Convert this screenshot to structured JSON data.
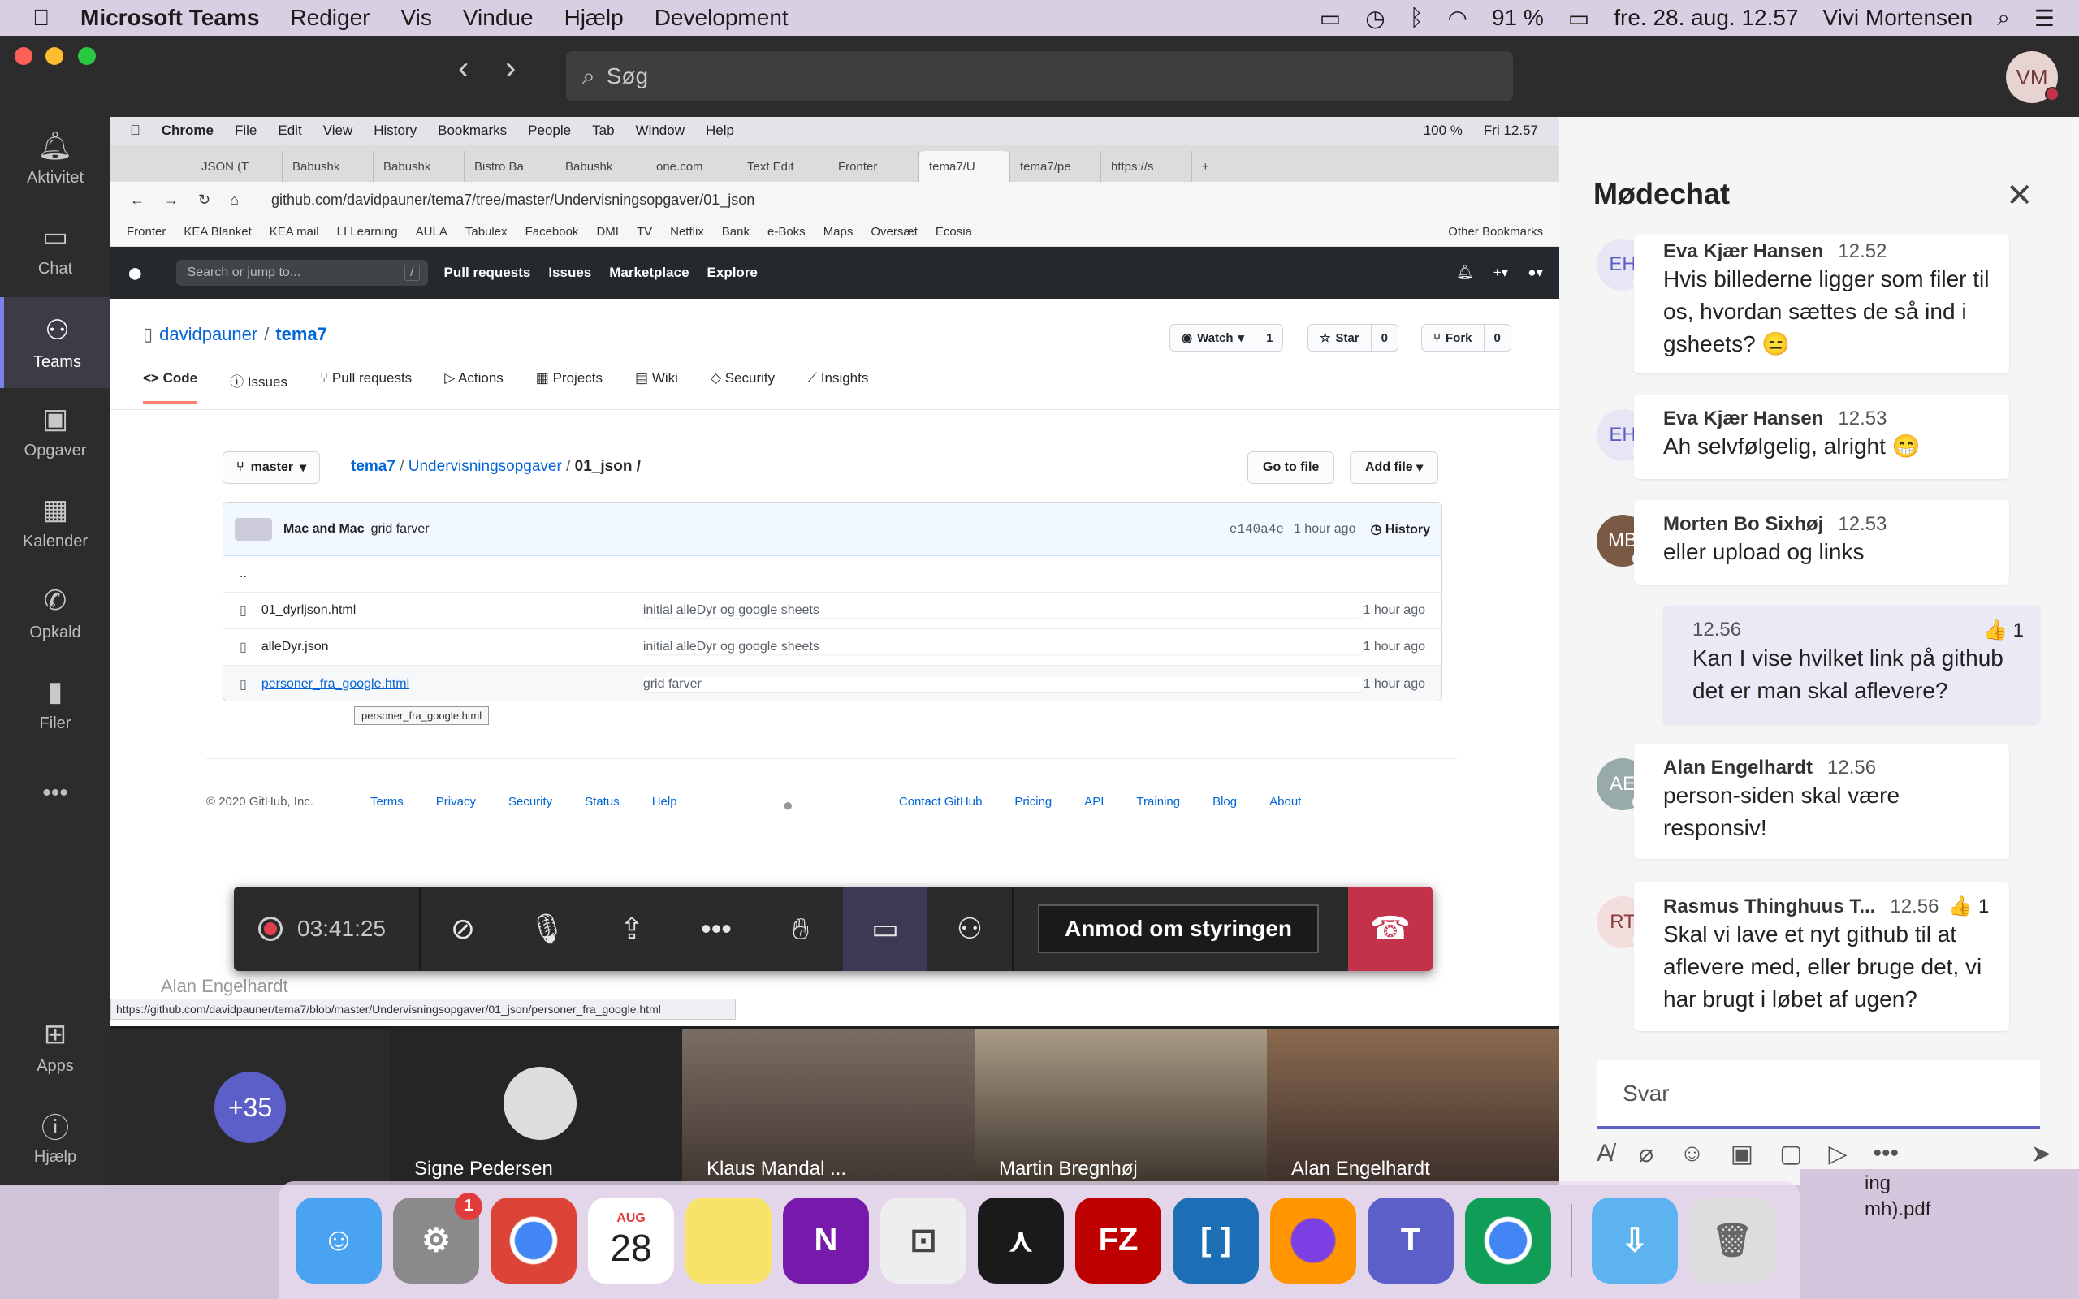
{
  "menubar": {
    "app": "Microsoft Teams",
    "items": [
      "Rediger",
      "Vis",
      "Vindue",
      "Hjælp",
      "Development"
    ],
    "battery": "91 %",
    "datetime": "fre. 28. aug. 12.57",
    "user": "Vivi Mortensen"
  },
  "teams": {
    "search_placeholder": "Søg",
    "avatar": "VM",
    "rail": [
      {
        "label": "Aktivitet",
        "icon": "bell-icon"
      },
      {
        "label": "Chat",
        "icon": "chat-icon"
      },
      {
        "label": "Teams",
        "icon": "teams-icon"
      },
      {
        "label": "Opgaver",
        "icon": "tasks-icon"
      },
      {
        "label": "Kalender",
        "icon": "calendar-icon"
      },
      {
        "label": "Opkald",
        "icon": "phone-icon"
      },
      {
        "label": "Filer",
        "icon": "files-icon"
      }
    ],
    "more": "•••",
    "apps": "Apps",
    "help": "Hjælp"
  },
  "chrome": {
    "mac_menu": [
      "Chrome",
      "File",
      "Edit",
      "View",
      "History",
      "Bookmarks",
      "People",
      "Tab",
      "Window",
      "Help"
    ],
    "mac_status": "100 %",
    "mac_time": "Fri 12.57",
    "tabs": [
      "JSON (T",
      "Babushk",
      "Babushk",
      "Bistro Ba",
      "Babushk",
      "one.com",
      "Text Edit",
      "Fronter",
      "tema7/U",
      "tema7/pe",
      "https://s"
    ],
    "url": "github.com/davidpauner/tema7/tree/master/Undervisningsopgaver/01_json",
    "bookmarks": [
      "Fronter",
      "KEA Blanket",
      "KEA mail",
      "LI Learning",
      "AULA",
      "Tabulex",
      "Facebook",
      "DMI",
      "TV",
      "Netflix",
      "Bank",
      "e-Boks",
      "Maps",
      "Oversæt",
      "Ecosia"
    ],
    "other_bookmarks": "Other Bookmarks",
    "status_url": "https://github.com/davidpauner/tema7/blob/master/Undervisningsopgaver/01_json/personer_fra_google.html"
  },
  "github": {
    "search": "Search or jump to...",
    "search_key": "/",
    "nav": [
      "Pull requests",
      "Issues",
      "Marketplace",
      "Explore"
    ],
    "owner": "davidpauner",
    "repo": "tema7",
    "watch": "Watch",
    "watch_count": "1",
    "star": "Star",
    "star_count": "0",
    "fork": "Fork",
    "fork_count": "0",
    "tabs": [
      "Code",
      "Issues",
      "Pull requests",
      "Actions",
      "Projects",
      "Wiki",
      "Security",
      "Insights"
    ],
    "branch": "master",
    "path_repo": "tema7",
    "path_dir": "Undervisningsopgaver",
    "path_cur": "01_json /",
    "go_to_file": "Go to file",
    "add_file": "Add file",
    "commit_authors": "Mac and Mac",
    "commit_msg": "grid farver",
    "commit_hash": "e140a4e",
    "commit_age": "1 hour ago",
    "history": "History",
    "updir": "..",
    "files": [
      {
        "name": "01_dyrljson.html",
        "msg": "initial alleDyr og google sheets",
        "age": "1 hour ago"
      },
      {
        "name": "alleDyr.json",
        "msg": "initial alleDyr og google sheets",
        "age": "1 hour ago"
      },
      {
        "name": "personer_fra_google.html",
        "msg": "grid farver",
        "age": "1 hour ago"
      }
    ],
    "tooltip": "personer_fra_google.html",
    "footer_copy": "© 2020 GitHub, Inc.",
    "footer_left": [
      "Terms",
      "Privacy",
      "Security",
      "Status",
      "Help"
    ],
    "footer_right": [
      "Contact GitHub",
      "Pricing",
      "API",
      "Training",
      "Blog",
      "About"
    ]
  },
  "call": {
    "timer": "03:41:25",
    "request_control": "Anmod om styringen",
    "presenter_overlay": "Alan Engelhardt"
  },
  "videos": {
    "more_count": "+35",
    "tiles": [
      "Signe Pedersen",
      "Klaus Mandal ...",
      "Martin Bregnhøj",
      "Alan Engelhardt"
    ]
  },
  "chat": {
    "title": "Mødechat",
    "messages": [
      {
        "initials": "EH",
        "name": "Eva Kjær Hansen",
        "time": "12.52",
        "text": "Hvis billederne ligger som filer til os, hvordan sættes de så ind i gsheets? 😑"
      },
      {
        "initials": "EH",
        "name": "Eva Kjær Hansen",
        "time": "12.53",
        "text": "Ah selvfølgelig, alright 😁"
      },
      {
        "initials": "MB",
        "name": "Morten Bo Sixhøj",
        "time": "12.53",
        "text": "eller upload og links"
      },
      {
        "initials": "",
        "name": "",
        "time": "12.56",
        "reaction": "👍 1",
        "text": "Kan I vise hvilket link på github det er man skal aflevere?"
      },
      {
        "initials": "AE",
        "name": "Alan Engelhardt",
        "time": "12.56",
        "text": "person-siden skal være responsiv!"
      },
      {
        "initials": "RT",
        "name": "Rasmus Thinghuus T...",
        "time": "12.56",
        "reaction": "👍 1",
        "text": "Skal vi lave et nyt github til at aflevere med, eller bruge det, vi har brugt i løbet af ugen?"
      }
    ],
    "reply_placeholder": "Svar"
  },
  "dock": {
    "calendar_month": "AUG",
    "calendar_day": "28",
    "badge": "1",
    "desktop_file": "mh).pdf",
    "desktop_file2": "ing"
  }
}
